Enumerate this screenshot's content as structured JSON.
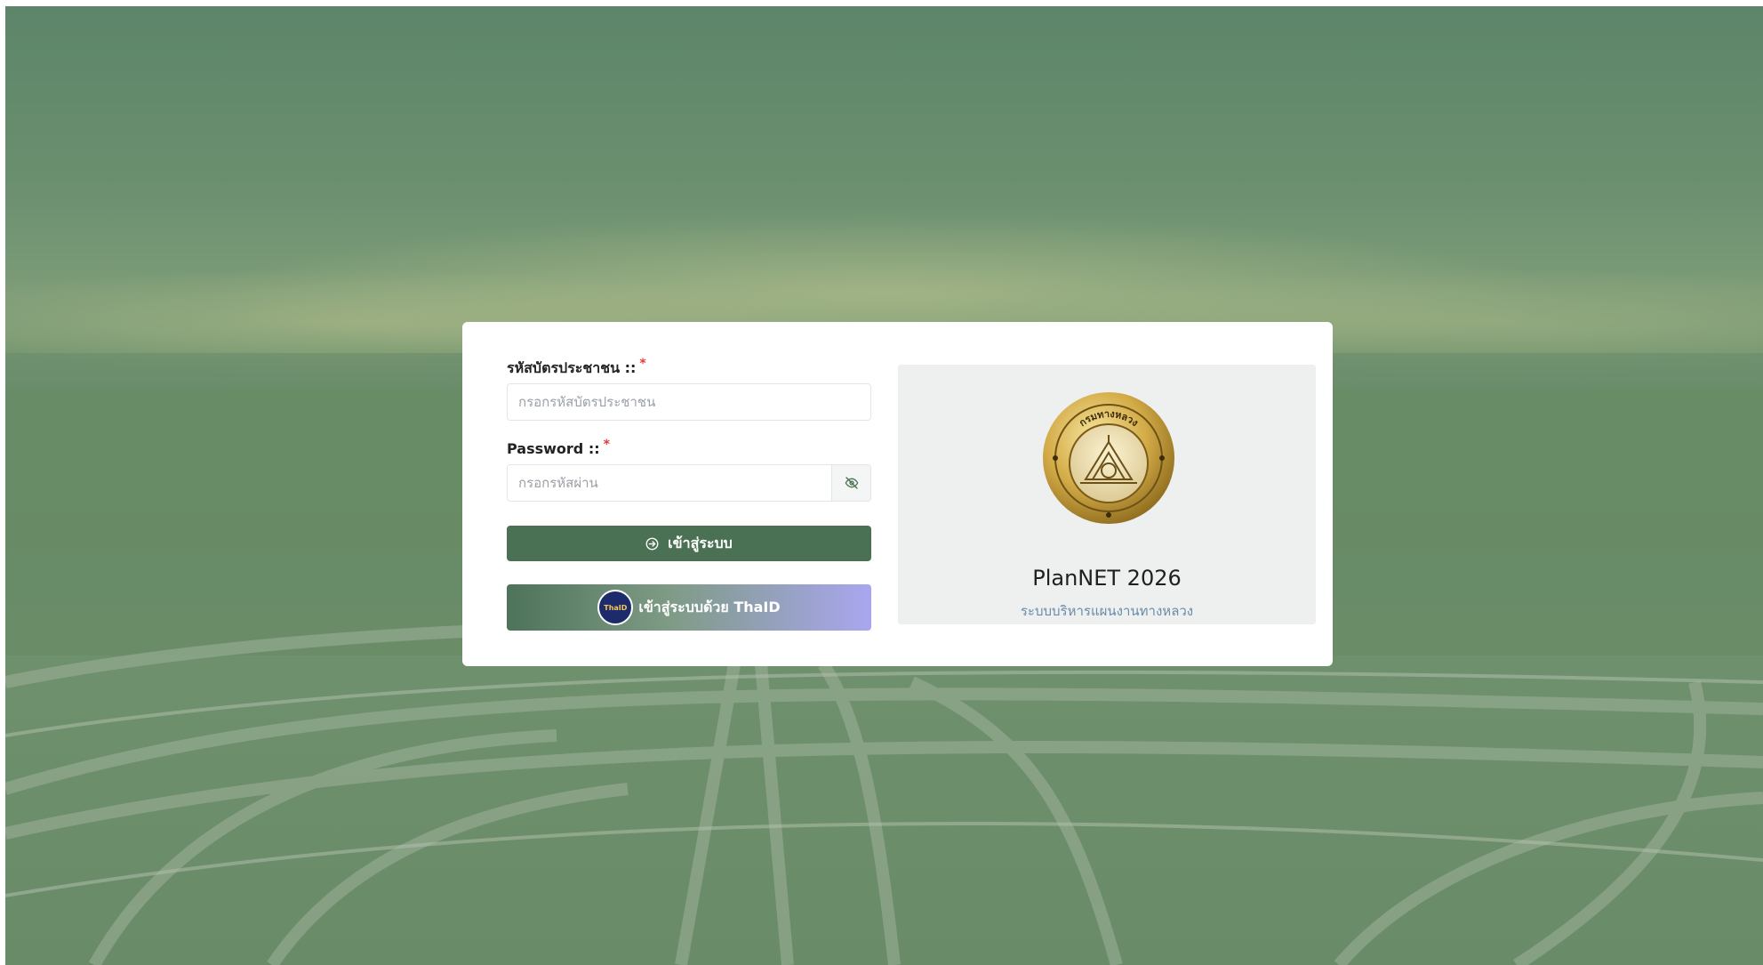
{
  "login": {
    "id_label": "รหัสบัตรประชาชน ::",
    "required_mark": "*",
    "id_placeholder": "กรอกรหัสบัตรประชาชน",
    "password_label": "Password ::",
    "password_placeholder": "กรอกรหัสผ่าน",
    "login_button": "เข้าสู่ระบบ",
    "thaid_button": "เข้าสู่ระบบด้วย ThaID",
    "thaid_logo_text": "ThaID"
  },
  "brand": {
    "title": "PlanNET 2026",
    "subtitle": "ระบบบริหารแผนงานทางหลวง",
    "seal_text": "กรมทางหลวง"
  },
  "colors": {
    "primary": "#4a7153",
    "required": "#e53935",
    "panel": "#eef0ef",
    "seal_gold": "#c9a33c"
  },
  "icons": {
    "password_toggle": "eye-off-icon",
    "login": "login-circle-icon",
    "thaid": "thaid-logo"
  }
}
